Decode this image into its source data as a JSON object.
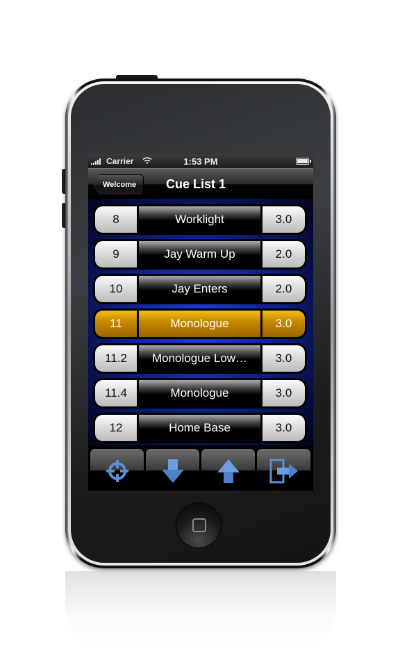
{
  "status_bar": {
    "carrier": "Carrier",
    "time": "1:53 PM",
    "signal_icon": "signal-bars-icon",
    "wifi_icon": "wifi-icon",
    "battery_icon": "battery-icon",
    "battery_level": 1.0
  },
  "nav_bar": {
    "back_label": "Welcome",
    "title": "Cue List 1"
  },
  "cues": [
    {
      "number": "8",
      "name": "Worklight",
      "time": "3.0",
      "active": false
    },
    {
      "number": "9",
      "name": "Jay Warm Up",
      "time": "2.0",
      "active": false
    },
    {
      "number": "10",
      "name": "Jay Enters",
      "time": "2.0",
      "active": false
    },
    {
      "number": "11",
      "name": "Monologue",
      "time": "3.0",
      "active": true
    },
    {
      "number": "11.2",
      "name": "Monologue Low…",
      "time": "3.0",
      "active": false
    },
    {
      "number": "11.4",
      "name": "Monologue",
      "time": "3.0",
      "active": false
    },
    {
      "number": "12",
      "name": "Home Base",
      "time": "3.0",
      "active": false
    }
  ],
  "toolbar": {
    "buttons": [
      {
        "icon": "crosshair-icon",
        "action": "go-to-active-cue"
      },
      {
        "icon": "arrow-down-icon",
        "action": "next-cue"
      },
      {
        "icon": "arrow-up-icon",
        "action": "previous-cue"
      },
      {
        "icon": "exit-icon",
        "action": "exit"
      }
    ]
  },
  "colors": {
    "active_cue": "#c88a00",
    "list_background": "#1c3cd8",
    "toolbar_icon": "#5b8fd6"
  }
}
